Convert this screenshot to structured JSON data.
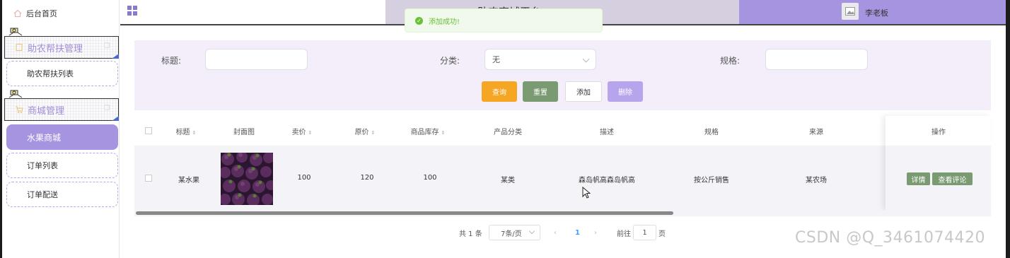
{
  "sidebar": {
    "home_label": "后台首页",
    "groups": [
      {
        "label": "助农帮扶管理",
        "items": [
          {
            "label": "助农帮扶列表"
          }
        ]
      },
      {
        "label": "商城管理",
        "items": [
          {
            "label": "水果商城",
            "active": true
          },
          {
            "label": "订单列表"
          },
          {
            "label": "订单配送"
          }
        ]
      }
    ]
  },
  "header": {
    "title": "助农商城平台",
    "user_name": "李老板"
  },
  "toast": {
    "text": "添加成功!"
  },
  "search": {
    "title_label": "标题:",
    "title_value": "",
    "category_label": "分类:",
    "category_value": "无",
    "spec_label": "规格:",
    "spec_value": "",
    "buttons": {
      "query": "查询",
      "reset": "重置",
      "add": "添加",
      "delete": "删除"
    }
  },
  "table": {
    "headers": [
      "标题",
      "封面图",
      "卖价",
      "原价",
      "商品库存",
      "产品分类",
      "描述",
      "规格",
      "来源",
      "操作"
    ],
    "rows": [
      {
        "title": "某水果",
        "cover": "mangosteen-image",
        "price": "100",
        "original_price": "120",
        "stock": "100",
        "category": "某类",
        "description": "森岛帆高森岛帆高",
        "spec": "按公斤销售",
        "source": "某农场",
        "actions": {
          "detail": "详情",
          "comments": "查看评论"
        }
      }
    ]
  },
  "pagination": {
    "total": "共 1 条",
    "page_size": "7条/页",
    "current_page": "1",
    "goto_label": "前往",
    "goto_value": "1",
    "page_suffix": "页"
  },
  "watermark": "CSDN @Q_3461074420",
  "colors": {
    "accent": "#a794e0",
    "query": "#f5a623",
    "reset": "#7a9a72",
    "panel": "#f3eef9"
  }
}
